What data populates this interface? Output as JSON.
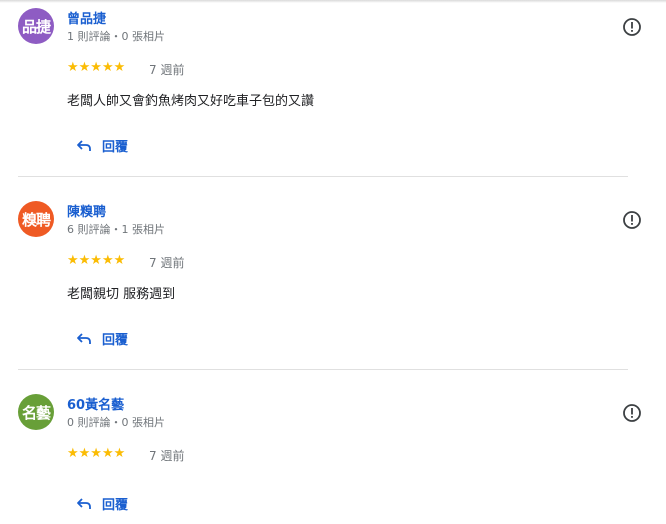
{
  "colors": {
    "link": "#1a5fd0",
    "star": "#fbbc04",
    "muted": "#70757a"
  },
  "reviews": [
    {
      "avatar_text": "品捷",
      "avatar_color": "#8e5cc3",
      "name": "曾品捷",
      "meta": "1 則評論・0 張相片",
      "stars": "★★★★★",
      "rating": 5,
      "time": "7 週前",
      "text": "老闆人帥又會釣魚烤肉又好吃車子包的又讚",
      "reply_label": "回覆"
    },
    {
      "avatar_text": "糗聘",
      "avatar_color": "#ef5a24",
      "name": "陳糗聘",
      "meta": "6 則評論・1 張相片",
      "stars": "★★★★★",
      "rating": 5,
      "time": "7 週前",
      "text": "老闆親切 服務週到",
      "reply_label": "回覆"
    },
    {
      "avatar_text": "名藝",
      "avatar_color": "#689f38",
      "name": "60黃名藝",
      "meta": "0 則評論・0 張相片",
      "stars": "★★★★★",
      "rating": 5,
      "time": "7 週前",
      "text": "",
      "reply_label": "回覆"
    }
  ]
}
